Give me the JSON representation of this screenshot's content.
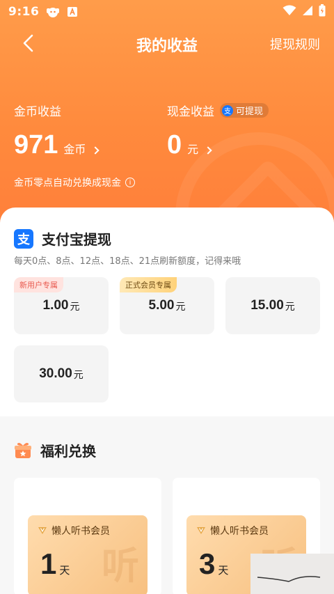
{
  "status_bar": {
    "time": "9:16"
  },
  "nav": {
    "title": "我的收益",
    "rules": "提现规则"
  },
  "coins": {
    "label": "金币收益",
    "value": "971",
    "unit": "金币"
  },
  "cash": {
    "label": "现金收益",
    "badge": "可提现",
    "value": "0",
    "unit": "元"
  },
  "auto_note": "金币零点自动兑换成现金",
  "alipay": {
    "title": "支付宝提现",
    "subtitle": "每天0点、8点、12点、18点、21点刷新额度，记得来哦",
    "amounts": [
      {
        "value": "1.00",
        "unit": "元",
        "tag": "新用户专属"
      },
      {
        "value": "5.00",
        "unit": "元",
        "tag": "正式会员专属"
      },
      {
        "value": "15.00",
        "unit": "元",
        "tag": ""
      },
      {
        "value": "30.00",
        "unit": "元",
        "tag": ""
      }
    ]
  },
  "welfare": {
    "title": "福利兑换",
    "cards": [
      {
        "name": "懒人听书会员",
        "days": "1",
        "unit": "天"
      },
      {
        "name": "懒人听书会员",
        "days": "3",
        "unit": "天"
      }
    ]
  },
  "colors": {
    "header_orange": "#ff8a3d",
    "alipay_blue": "#1677ff"
  }
}
